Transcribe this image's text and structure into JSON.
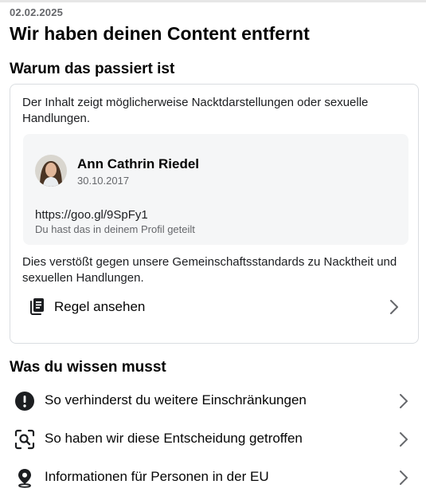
{
  "header": {
    "date": "02.02.2025",
    "title": "Wir haben deinen Content entfernt"
  },
  "reason": {
    "section_title": "Warum das passiert ist",
    "description": "Der Inhalt zeigt möglicherweise Nacktdarstellungen oder sexuelle Handlungen.",
    "post": {
      "author": "Ann Cathrin Riedel",
      "date": "30.10.2017",
      "link": "https://goo.gl/9SpFy1",
      "note": "Du hast das in deinem Profil geteilt"
    },
    "violation": "Dies verstößt gegen unsere Gemeinschaftsstandards zu Nacktheit und sexuellen Handlungen.",
    "rule_link": {
      "label": "Regel ansehen",
      "icon": "document-icon"
    }
  },
  "info": {
    "section_title": "Was du wissen musst",
    "items": [
      {
        "label": "So verhinderst du weitere Einschränkungen",
        "icon": "exclamation-icon"
      },
      {
        "label": "So haben wir diese Entscheidung getroffen",
        "icon": "face-scan-icon"
      },
      {
        "label": "Informationen für Personen in der EU",
        "icon": "location-pin-icon"
      }
    ]
  },
  "colors": {
    "text": "#050505",
    "secondary": "#65676b",
    "card_border": "#dadde1",
    "post_bg": "#f5f6f7"
  }
}
